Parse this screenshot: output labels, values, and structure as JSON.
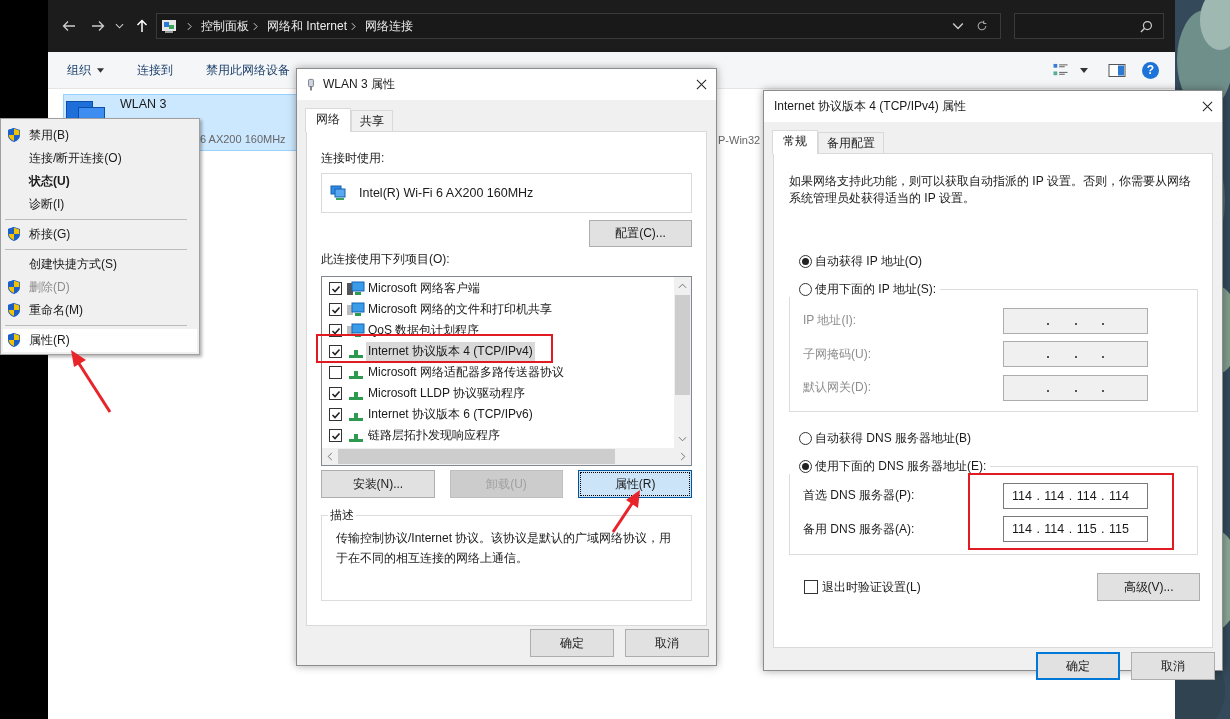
{
  "explorer": {
    "breadcrumb": [
      "控制面板",
      "网络和 Internet",
      "网络连接"
    ],
    "toolbar": [
      {
        "label": "组织",
        "dropdown": true
      },
      {
        "label": "连接到",
        "dropdown": false
      },
      {
        "label": "禁用此网络设备",
        "dropdown": false
      }
    ],
    "help": "?",
    "connection": {
      "name": "WLAN 3",
      "device": "6 AX200 160MHz",
      "selected": true
    },
    "other_text": "P-Win32"
  },
  "context_menu": [
    {
      "kind": "item",
      "label": "禁用(B)",
      "shield": true,
      "default": false,
      "disabled": false,
      "selected": false
    },
    {
      "kind": "item",
      "label": "连接/断开连接(O)",
      "shield": false,
      "default": false,
      "disabled": false,
      "selected": false
    },
    {
      "kind": "item",
      "label": "状态(U)",
      "shield": false,
      "default": true,
      "disabled": false,
      "selected": false
    },
    {
      "kind": "item",
      "label": "诊断(I)",
      "shield": false,
      "default": false,
      "disabled": false,
      "selected": false
    },
    {
      "kind": "separator"
    },
    {
      "kind": "item",
      "label": "桥接(G)",
      "shield": true,
      "default": false,
      "disabled": false,
      "selected": false
    },
    {
      "kind": "separator"
    },
    {
      "kind": "item",
      "label": "创建快捷方式(S)",
      "shield": false,
      "default": false,
      "disabled": false,
      "selected": false
    },
    {
      "kind": "item",
      "label": "删除(D)",
      "shield": true,
      "default": false,
      "disabled": true,
      "selected": false
    },
    {
      "kind": "item",
      "label": "重命名(M)",
      "shield": true,
      "default": false,
      "disabled": false,
      "selected": false
    },
    {
      "kind": "separator"
    },
    {
      "kind": "item",
      "label": "属性(R)",
      "shield": true,
      "default": false,
      "disabled": false,
      "selected": true
    }
  ],
  "adapter_dialog": {
    "title": "WLAN 3 属性",
    "tabs": [
      {
        "label": "网络",
        "selected": true
      },
      {
        "label": "共享",
        "selected": false
      }
    ],
    "connect_using_label": "连接时使用:",
    "adapter": "Intel(R) Wi-Fi 6 AX200 160MHz",
    "configure_button": "配置(C)...",
    "items_label": "此连接使用下列项目(O):",
    "items": [
      {
        "kind": "client",
        "label": "Microsoft 网络客户端",
        "checked": true,
        "selected": false
      },
      {
        "kind": "service",
        "label": "Microsoft 网络的文件和打印机共享",
        "checked": true,
        "selected": false
      },
      {
        "kind": "service",
        "label": "QoS 数据包计划程序",
        "checked": true,
        "selected": false
      },
      {
        "kind": "protocol",
        "label": "Internet 协议版本 4 (TCP/IPv4)",
        "checked": true,
        "selected": true
      },
      {
        "kind": "protocol",
        "label": "Microsoft 网络适配器多路传送器协议",
        "checked": false,
        "selected": false
      },
      {
        "kind": "protocol",
        "label": "Microsoft LLDP 协议驱动程序",
        "checked": true,
        "selected": false
      },
      {
        "kind": "protocol",
        "label": "Internet 协议版本 6 (TCP/IPv6)",
        "checked": true,
        "selected": false
      },
      {
        "kind": "protocol",
        "label": "链路层拓扑发现响应程序",
        "checked": true,
        "selected": false
      }
    ],
    "buttons": [
      {
        "label": "安装(N)...",
        "disabled": false,
        "focused": false
      },
      {
        "label": "卸载(U)",
        "disabled": true,
        "focused": false
      },
      {
        "label": "属性(R)",
        "disabled": false,
        "focused": true
      }
    ],
    "description_title": "描述",
    "description": "传输控制协议/Internet 协议。该协议是默认的广域网络协议，用于在不同的相互连接的网络上通信。",
    "ok": "确定",
    "cancel": "取消"
  },
  "ipv4_dialog": {
    "title": "Internet 协议版本 4 (TCP/IPv4) 属性",
    "tabs": [
      {
        "label": "常规",
        "selected": true
      },
      {
        "label": "备用配置",
        "selected": false
      }
    ],
    "intro": "如果网络支持此功能，则可以获取自动指派的 IP 设置。否则，你需要从网络系统管理员处获得适当的 IP 设置。",
    "ip_mode": [
      {
        "label": "自动获得 IP 地址(O)",
        "selected": true
      },
      {
        "label": "使用下面的 IP 地址(S):",
        "selected": false
      }
    ],
    "ip_fields": [
      {
        "label": "IP 地址(I):"
      },
      {
        "label": "子网掩码(U):"
      },
      {
        "label": "默认网关(D):"
      }
    ],
    "dns_mode": [
      {
        "label": "自动获得 DNS 服务器地址(B)",
        "selected": false
      },
      {
        "label": "使用下面的 DNS 服务器地址(E):",
        "selected": true
      }
    ],
    "dns_fields": [
      {
        "label": "首选 DNS 服务器(P):",
        "value": "114 . 114 . 114 . 114"
      },
      {
        "label": "备用 DNS 服务器(A):",
        "value": "114 . 114 . 115 . 115"
      }
    ],
    "validate": {
      "label": "退出时验证设置(L)",
      "checked": false
    },
    "advanced_button": "高级(V)...",
    "ok": "确定",
    "cancel": "取消"
  }
}
